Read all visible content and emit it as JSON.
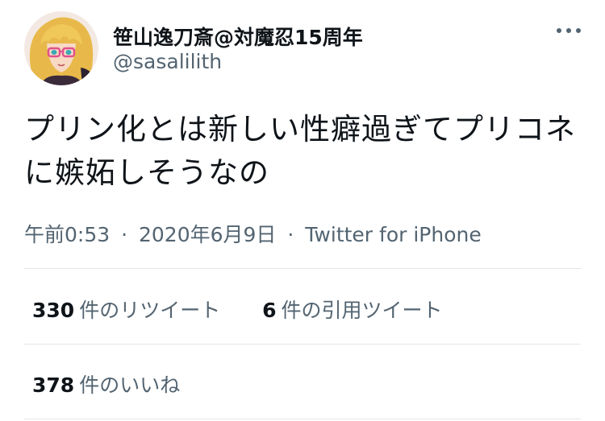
{
  "author": {
    "display_name": "笹山逸刀斎@対魔忍15周年",
    "handle": "@sasalilith",
    "avatar_icon": "avatar-blonde-anime-character"
  },
  "more_icon": "more-options-icon",
  "tweet": {
    "text": "プリン化とは新しい性癖過ぎてプリコネに嫉妬しそうなの",
    "time": "午前0:53",
    "separator": "·",
    "date": "2020年6月9日",
    "source": "Twitter for iPhone"
  },
  "stats": {
    "retweets": {
      "count": "330",
      "label": "件のリツイート"
    },
    "quotes": {
      "count": "6",
      "label": "件の引用ツイート"
    },
    "likes": {
      "count": "378",
      "label": "件のいいね"
    }
  },
  "colors": {
    "text_primary": "#0f1419",
    "text_secondary": "#536471",
    "divider": "#e3e6e8"
  }
}
